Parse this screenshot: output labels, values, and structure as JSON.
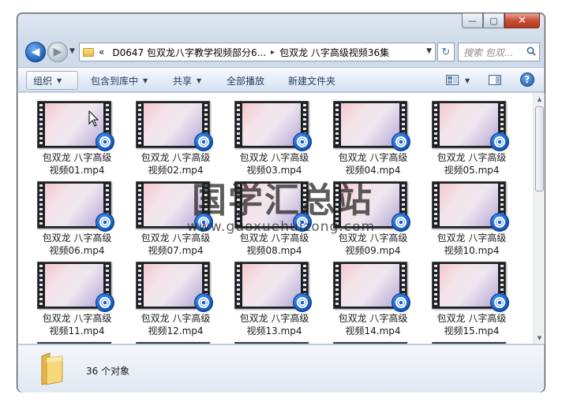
{
  "titlebar": {
    "minimize_label": "—",
    "maximize_label": "▢",
    "close_label": "✕"
  },
  "nav": {
    "back_label": "◀",
    "forward_label": "▶",
    "recent_label": "▼",
    "breadcrumb_prefix": "«",
    "breadcrumb_parent": "D0647 包双龙八字教学视频部分6...",
    "breadcrumb_separator": "▸",
    "breadcrumb_current": "包双龙 八字高级视频36集",
    "address_dropdown": "▼",
    "refresh_label": "↻",
    "search_placeholder": "搜索 包双..."
  },
  "toolbar": {
    "organize": "组织",
    "include_in_library": "包含到库中",
    "share": "共享",
    "play_all": "全部播放",
    "new_folder": "新建文件夹",
    "caret": "▼",
    "help_label": "?"
  },
  "files": [
    {
      "line1": "包双龙 八字高级",
      "line2": "视频01.mp4"
    },
    {
      "line1": "包双龙 八字高级",
      "line2": "视频02.mp4"
    },
    {
      "line1": "包双龙 八字高级",
      "line2": "视频03.mp4"
    },
    {
      "line1": "包双龙 八字高级",
      "line2": "视频04.mp4"
    },
    {
      "line1": "包双龙 八字高级",
      "line2": "视频05.mp4"
    },
    {
      "line1": "包双龙 八字高级",
      "line2": "视频06.mp4"
    },
    {
      "line1": "包双龙 八字高级",
      "line2": "视频07.mp4"
    },
    {
      "line1": "包双龙 八字高级",
      "line2": "视频08.mp4"
    },
    {
      "line1": "包双龙 八字高级",
      "line2": "视频09.mp4"
    },
    {
      "line1": "包双龙 八字高级",
      "line2": "视频10.mp4"
    },
    {
      "line1": "包双龙 八字高级",
      "line2": "视频11.mp4"
    },
    {
      "line1": "包双龙 八字高级",
      "line2": "视频12.mp4"
    },
    {
      "line1": "包双龙 八字高级",
      "line2": "视频13.mp4"
    },
    {
      "line1": "包双龙 八字高级",
      "line2": "视频14.mp4"
    },
    {
      "line1": "包双龙 八字高级",
      "line2": "视频15.mp4"
    },
    {
      "line1": "",
      "line2": ""
    },
    {
      "line1": "",
      "line2": ""
    },
    {
      "line1": "",
      "line2": ""
    },
    {
      "line1": "",
      "line2": ""
    },
    {
      "line1": "",
      "line2": ""
    }
  ],
  "scrollbar": {
    "up_label": "▲",
    "down_label": "▼"
  },
  "status": {
    "item_count": "36 个对象"
  },
  "watermark": {
    "title": "国学汇总站",
    "url": "www.guoxuehuizong.com"
  },
  "colors": {
    "accent": "#1d5fb8",
    "close_button": "#c74f35"
  }
}
